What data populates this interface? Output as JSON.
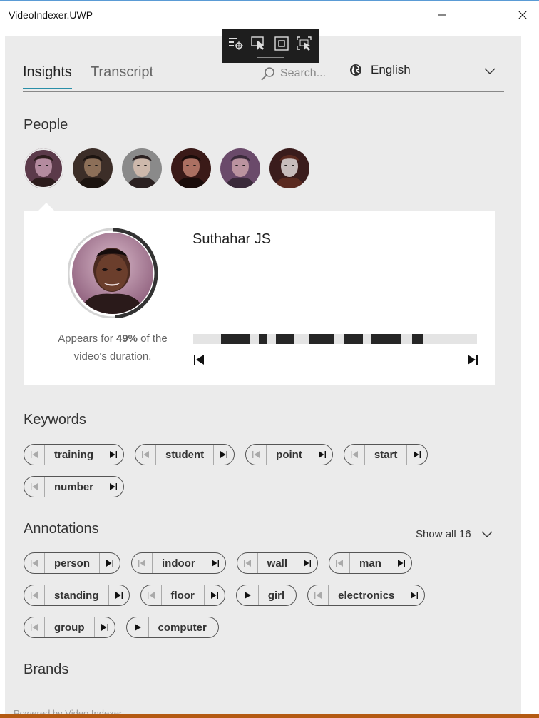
{
  "window": {
    "title": "VideoIndexer.UWP"
  },
  "tabs": [
    {
      "label": "Insights"
    },
    {
      "label": "Transcript"
    }
  ],
  "search": {
    "placeholder": "Search..."
  },
  "language": {
    "selected": "English"
  },
  "sections": {
    "people": "People",
    "keywords": "Keywords",
    "annotations": "Annotations",
    "brands": "Brands"
  },
  "person": {
    "name": "Suthahar JS",
    "appears_prefix": "Appears for ",
    "appears_percent": "49%",
    "appears_suffix": " of the video's duration.",
    "appearance_fraction": 0.49,
    "timeline_segments": [
      {
        "start": 0.098,
        "end": 0.198
      },
      {
        "start": 0.232,
        "end": 0.26
      },
      {
        "start": 0.292,
        "end": 0.354
      },
      {
        "start": 0.41,
        "end": 0.498
      },
      {
        "start": 0.529,
        "end": 0.597
      },
      {
        "start": 0.625,
        "end": 0.731
      },
      {
        "start": 0.771,
        "end": 0.808
      }
    ]
  },
  "people_colors": [
    [
      "#5b3a4a",
      "#c49aae",
      "#2c1c1c"
    ],
    [
      "#3c2e28",
      "#9a7a60",
      "#1c1410"
    ],
    [
      "#8a8a8a",
      "#d8c0b0",
      "#2a2020"
    ],
    [
      "#3a1a18",
      "#c08070",
      "#1a0c0a"
    ],
    [
      "#6a4a6a",
      "#c8a0a8",
      "#3a2a3a"
    ],
    [
      "#3a1c1c",
      "#e0d8d8",
      "#5a2a20"
    ]
  ],
  "keywords": [
    {
      "label": "training"
    },
    {
      "label": "student"
    },
    {
      "label": "point"
    },
    {
      "label": "start"
    },
    {
      "label": "number"
    }
  ],
  "annotations": {
    "show_all": "Show all 16",
    "items": [
      {
        "label": "person",
        "type": "nav"
      },
      {
        "label": "indoor",
        "type": "nav"
      },
      {
        "label": "wall",
        "type": "nav"
      },
      {
        "label": "man",
        "type": "nav"
      },
      {
        "label": "standing",
        "type": "nav"
      },
      {
        "label": "floor",
        "type": "nav"
      },
      {
        "label": "girl",
        "type": "play"
      },
      {
        "label": "electronics",
        "type": "nav"
      },
      {
        "label": "group",
        "type": "nav"
      },
      {
        "label": "computer",
        "type": "play"
      }
    ]
  },
  "footer": {
    "text": "Powered by Video Indexer"
  },
  "colors": {
    "accent": "#2a8fa8",
    "panel": "#ebebeb",
    "timeline_fill": "#262626",
    "bottom_bar": "#b45a12"
  }
}
